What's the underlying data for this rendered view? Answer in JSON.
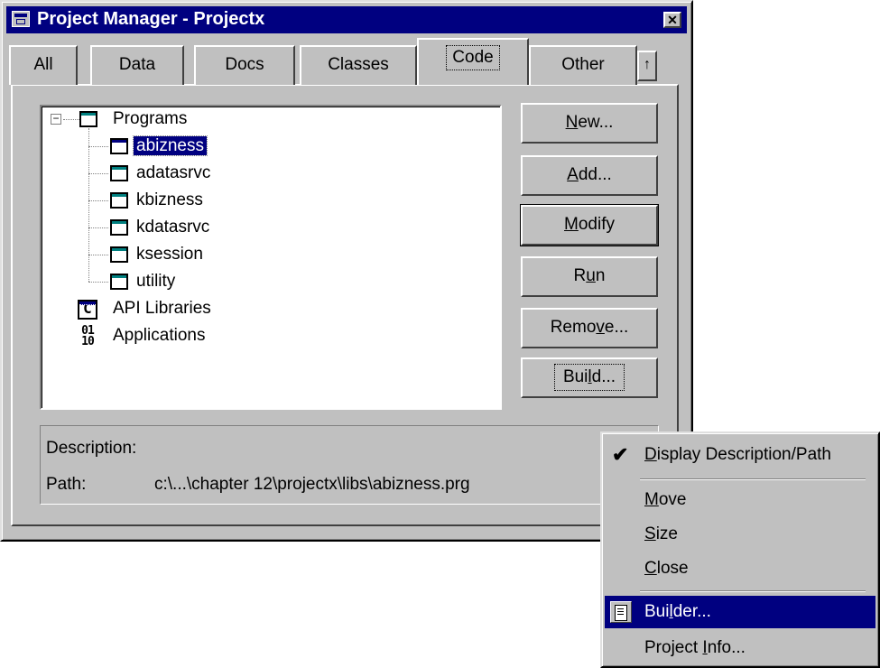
{
  "window": {
    "title": "Project Manager - Projectx"
  },
  "tabs": [
    {
      "label": "All"
    },
    {
      "label": "Data"
    },
    {
      "label": "Docs"
    },
    {
      "label": "Classes"
    },
    {
      "label": "Code",
      "active": true
    },
    {
      "label": "Other"
    }
  ],
  "tree": {
    "root": "Programs",
    "programs": [
      "abizness",
      "adatasrvc",
      "kbizness",
      "kdatasrvc",
      "ksession",
      "utility"
    ],
    "selected": "abizness",
    "api_libraries": "API Libraries",
    "applications": "Applications"
  },
  "buttons": {
    "new": {
      "pre": "",
      "key": "N",
      "post": "ew..."
    },
    "add": {
      "pre": "",
      "key": "A",
      "post": "dd..."
    },
    "modify": {
      "pre": "",
      "key": "M",
      "post": "odify"
    },
    "run": {
      "pre": "R",
      "key": "u",
      "post": "n"
    },
    "remove": {
      "pre": "Remo",
      "key": "v",
      "post": "e..."
    },
    "build": {
      "pre": "Bui",
      "key": "l",
      "post": "d..."
    }
  },
  "description": {
    "desc_label": "Description:",
    "path_label": "Path:",
    "path_value": "c:\\...\\chapter 12\\projectx\\libs\\abizness.prg"
  },
  "context_menu": {
    "display": {
      "pre": "",
      "key": "D",
      "post": "isplay Description/Path",
      "checked": true
    },
    "move": {
      "pre": "",
      "key": "M",
      "post": "ove"
    },
    "size": {
      "pre": "",
      "key": "S",
      "post": "ize"
    },
    "close": {
      "pre": "",
      "key": "C",
      "post": "lose"
    },
    "builder": {
      "pre": "Bui",
      "key": "l",
      "post": "der..."
    },
    "project_info": {
      "pre": "Project ",
      "key": "I",
      "post": "nfo..."
    }
  },
  "icons": {
    "app": "window-icon",
    "close": "close-icon",
    "program": "program-window-icon",
    "api": "c-library-icon",
    "applications": "binary-app-icon",
    "check": "check-icon",
    "builder": "builder-icon"
  }
}
